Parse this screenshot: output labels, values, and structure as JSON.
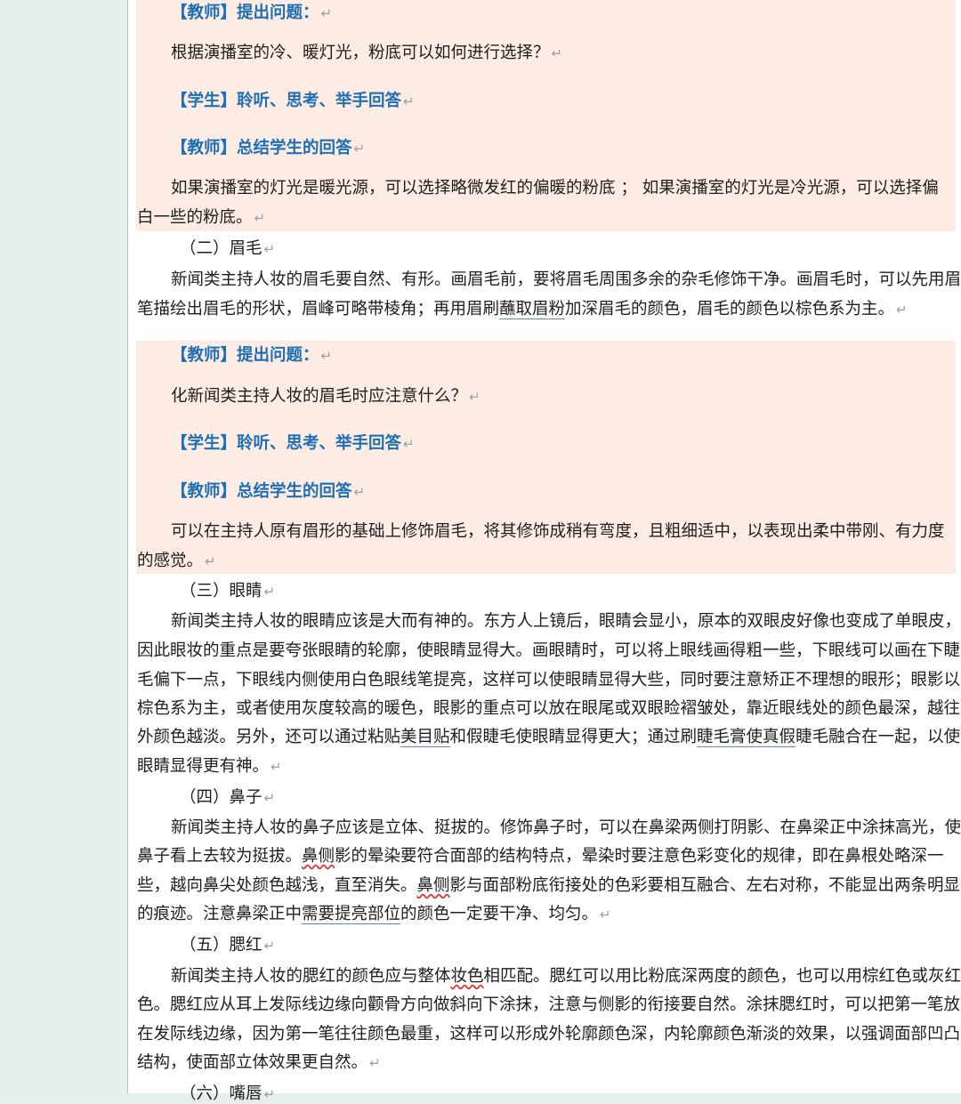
{
  "block1": {
    "q_tag": "【教师】提出问题：",
    "q_text": "根据演播室的冷、暖灯光，粉底可以如何进行选择？",
    "s_tag": "【学生】聆听、思考、举手回答",
    "t_tag": "【教师】总结学生的回答",
    "ans_l1": "如果演播室的灯光是暖光源，可以选择略微发红的偏暖的粉底 ； 如果演播室的灯光是冷光源，可以选择偏",
    "ans_l2": "白一些的粉底。"
  },
  "sec2": {
    "heading": "（二）眉毛",
    "l1": "新闻类主持人妆的眉毛要自然、有形。画眉毛前，要将眉毛周围多余的杂毛修饰干净。画眉毛时，可以先用眉",
    "l2a": "笔描绘出眉毛的形状，眉峰可略带棱角；再用眉刷",
    "l2u": "蘸取眉粉",
    "l2b": "加深眉毛的颜色，眉毛的颜色以棕色系为主。"
  },
  "block2": {
    "q_tag": "【教师】提出问题：",
    "q_text": "化新闻类主持人妆的眉毛时应注意什么？",
    "s_tag": "【学生】聆听、思考、举手回答",
    "t_tag": "【教师】总结学生的回答",
    "ans_l1": "可以在主持人原有眉形的基础上修饰眉毛，将其修饰成稍有弯度，且粗细适中，以表现出柔中带刚、有力度",
    "ans_l2": "的感觉。"
  },
  "sec3": {
    "heading": "（三）眼睛",
    "l1": "新闻类主持人妆的眼睛应该是大而有神的。东方人上镜后，眼睛会显小，原本的双眼皮好像也变成了单眼皮，",
    "l2": "因此眼妆的重点是要夸张眼睛的轮廓，使眼睛显得大。画眼睛时，可以将上眼线画得粗一些，下眼线可以画在下睫",
    "l3": "毛偏下一点，下眼线内侧使用白色眼线笔提亮，这样可以使眼睛显得大些，同时要注意矫正不理想的眼形；眼影以",
    "l4": "棕色系为主，或者使用灰度较高的暖色，眼影的重点可以放在眼尾或双眼睑褶皱处，靠近眼线处的颜色最深，越往",
    "l5a": "外颜色越淡。另外，还可以通过粘贴",
    "l5u1": "美目贴",
    "l5b": "和假睫毛使眼睛显得更大；通过刷",
    "l5u2": "睫毛膏使真假",
    "l5c": "睫毛融合在一起，以使",
    "l6": "眼睛显得更有神。"
  },
  "sec4": {
    "heading": "（四）鼻子",
    "l1": "新闻类主持人妆的鼻子应该是立体、挺拔的。修饰鼻子时，可以在鼻梁两侧打阴影、在鼻梁正中涂抹高光，使",
    "l2a": "鼻子看上去较为挺拔。",
    "l2w": "鼻侧",
    "l2b": "影的晕染要符合面部的结构特点，晕染时要注意色彩变化的规律，即在鼻根处略深一",
    "l3a": "些，越向鼻尖处颜色越浅，直至消失。",
    "l3w": "鼻侧",
    "l3b": "影与面部粉底衔接处的色彩要相互融合、左右对称，不能显出两条明显",
    "l4a": "的痕迹。注意鼻梁正中",
    "l4u": "需要提亮部位",
    "l4b": "的颜色一定要干净、均匀。"
  },
  "sec5": {
    "heading": "（五）腮红",
    "l1a": "新闻类主持人妆的腮红的颜色应与整体",
    "l1w": "妆色",
    "l1b": "相匹配。腮红可以用比粉底深两度的颜色，也可以用棕红色或灰红",
    "l2": "色。腮红应从耳上发际线边缘向颧骨方向做斜向下涂抹，注意与侧影的衔接要自然。涂抹腮红时，可以把第一笔放",
    "l3": "在发际线边缘，因为第一笔往往颜色最重，这样可以形成外轮廓颜色深，内轮廓颜色渐淡的效果，以强调面部凹凸",
    "l4": "结构，使面部立体效果更自然。"
  },
  "sec6": {
    "heading": "（六）嘴唇"
  },
  "para_mark": "↵"
}
